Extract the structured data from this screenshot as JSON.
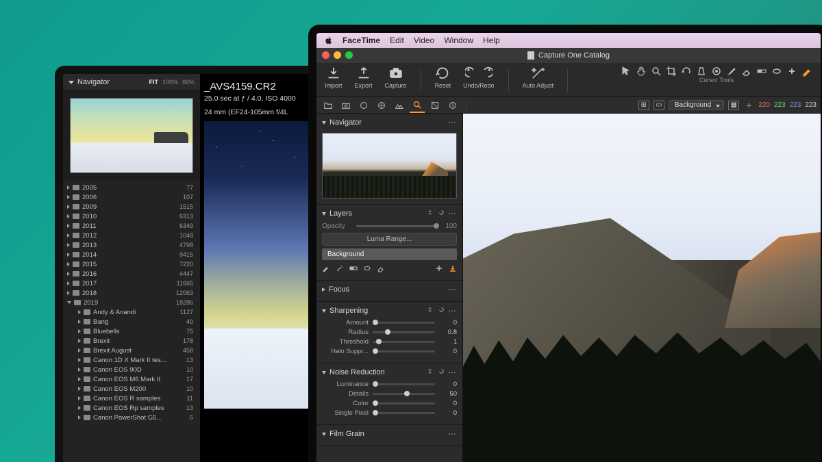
{
  "lightroom": {
    "navigator": {
      "title": "Navigator",
      "zoom_fit": "FIT",
      "zoom_100": "100%",
      "zoom_66": "66%"
    },
    "filename": "_AVS4159.CR2",
    "meta_line1": "25.0 sec at ƒ / 4.0, ISO 4000",
    "meta_line2": "24 mm (EF24-105mm f/4L",
    "folders": [
      {
        "name": "2005",
        "count": "77",
        "depth": 1,
        "open": false
      },
      {
        "name": "2006",
        "count": "107",
        "depth": 1,
        "open": false
      },
      {
        "name": "2009",
        "count": "1515",
        "depth": 1,
        "open": false
      },
      {
        "name": "2010",
        "count": "6313",
        "depth": 1,
        "open": false
      },
      {
        "name": "2011",
        "count": "6349",
        "depth": 1,
        "open": false
      },
      {
        "name": "2012",
        "count": "1048",
        "depth": 1,
        "open": false
      },
      {
        "name": "2013",
        "count": "4798",
        "depth": 1,
        "open": false
      },
      {
        "name": "2014",
        "count": "9415",
        "depth": 1,
        "open": false
      },
      {
        "name": "2015",
        "count": "7220",
        "depth": 1,
        "open": false
      },
      {
        "name": "2016",
        "count": "4447",
        "depth": 1,
        "open": false
      },
      {
        "name": "2017",
        "count": "11665",
        "depth": 1,
        "open": false
      },
      {
        "name": "2018",
        "count": "12063",
        "depth": 1,
        "open": false
      },
      {
        "name": "2019",
        "count": "18286",
        "depth": 1,
        "open": true
      },
      {
        "name": "Andy & Anandi",
        "count": "1127",
        "depth": 2,
        "open": false
      },
      {
        "name": "Bang",
        "count": "49",
        "depth": 2,
        "open": false
      },
      {
        "name": "Bluebells",
        "count": "75",
        "depth": 2,
        "open": false
      },
      {
        "name": "Brexit",
        "count": "178",
        "depth": 2,
        "open": false
      },
      {
        "name": "Brexit August",
        "count": "458",
        "depth": 2,
        "open": false
      },
      {
        "name": "Canon 1D X Mark II tes...",
        "count": "13",
        "depth": 2,
        "open": false
      },
      {
        "name": "Canon EOS 90D",
        "count": "10",
        "depth": 2,
        "open": false
      },
      {
        "name": "Canon EOS M6 Mark II",
        "count": "17",
        "depth": 2,
        "open": false
      },
      {
        "name": "Canon EOS M200",
        "count": "10",
        "depth": 2,
        "open": false
      },
      {
        "name": "Canon EOS R samples",
        "count": "11",
        "depth": 2,
        "open": false
      },
      {
        "name": "Canon EOS Rp samples",
        "count": "13",
        "depth": 2,
        "open": false
      },
      {
        "name": "Canon PowerShot G5...",
        "count": "5",
        "depth": 2,
        "open": false
      }
    ]
  },
  "mac": {
    "app": "FaceTime",
    "menus": [
      "Edit",
      "Video",
      "Window",
      "Help"
    ]
  },
  "captureone": {
    "window_title": "Capture One Catalog",
    "toolbar": {
      "import": "Import",
      "export": "Export",
      "capture": "Capture",
      "reset": "Reset",
      "undoredo": "Undo/Redo",
      "autoadjust": "Auto Adjust",
      "cursor_tools": "Cursor Tools"
    },
    "rgb": {
      "r": "220",
      "g": "223",
      "b": "223",
      "extra": "223"
    },
    "layer_dropdown": "Background",
    "panels": {
      "navigator": "Navigator",
      "layers": {
        "title": "Layers",
        "opacity_label": "Opacity",
        "opacity_value": "100",
        "luma": "Luma Range...",
        "background": "Background"
      },
      "focus": "Focus",
      "sharpening": {
        "title": "Sharpening",
        "rows": [
          {
            "label": "Amount",
            "value": "0",
            "pos": 0
          },
          {
            "label": "Radius",
            "value": "0.8",
            "pos": 20
          },
          {
            "label": "Threshold",
            "value": "1",
            "pos": 6
          },
          {
            "label": "Halo Suppr...",
            "value": "0",
            "pos": 0
          }
        ]
      },
      "noise": {
        "title": "Noise Reduction",
        "rows": [
          {
            "label": "Luminance",
            "value": "0",
            "pos": 0
          },
          {
            "label": "Details",
            "value": "50",
            "pos": 50
          },
          {
            "label": "Color",
            "value": "0",
            "pos": 0
          },
          {
            "label": "Single Pixel",
            "value": "0",
            "pos": 0
          }
        ]
      },
      "filmgrain": "Film Grain"
    }
  }
}
